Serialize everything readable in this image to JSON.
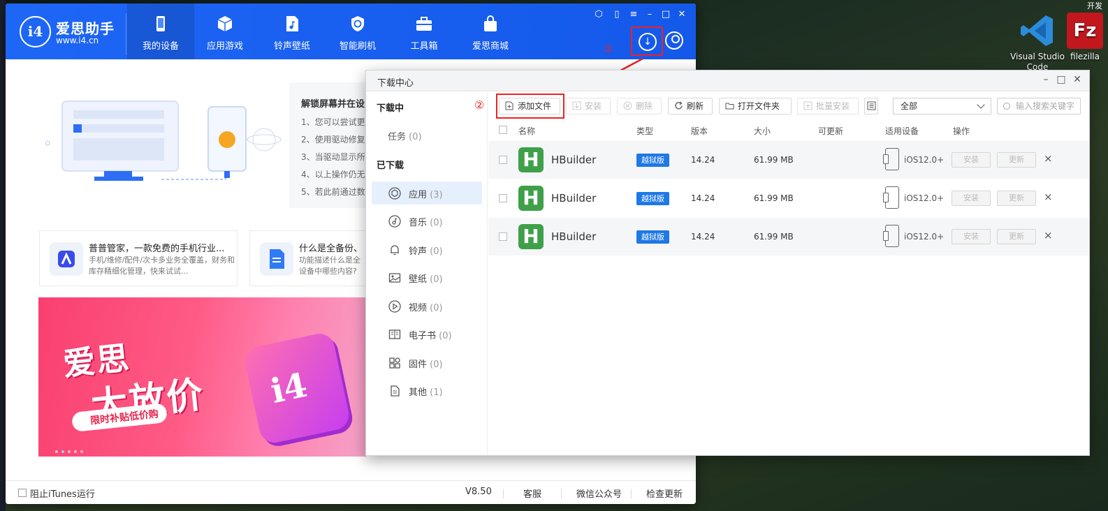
{
  "desktop": {
    "icons": [
      {
        "label": "Visual Studio Code",
        "color": "#2b8cdb"
      },
      {
        "label": "filezilla",
        "color": "#c2171d"
      }
    ],
    "topright_text": "开发"
  },
  "main": {
    "logo_mark": "i4",
    "logo_title": "爱思助手",
    "logo_url": "www.i4.cn",
    "nav": [
      {
        "label": "我的设备",
        "icon": "phone-icon"
      },
      {
        "label": "应用游戏",
        "icon": "cube-icon"
      },
      {
        "label": "铃声壁纸",
        "icon": "music-file-icon"
      },
      {
        "label": "智能刷机",
        "icon": "shield-refresh-icon"
      },
      {
        "label": "工具箱",
        "icon": "toolbox-icon"
      },
      {
        "label": "爱思商城",
        "icon": "shopping-bag-icon"
      }
    ],
    "annotation_1": "①",
    "download_arrow": "↓",
    "unlock": {
      "title": "解锁屏幕并在设",
      "steps": [
        "1、您可以尝试更",
        "2、使用驱动修复",
        "3、当驱动显示所",
        "4、以上操作仍无",
        "5、若此前通过数"
      ]
    },
    "cards": [
      {
        "title": "普普管家，一款免费的手机行业...",
        "desc": "手机/维修/配件/次卡多业务全覆盖，财务和库存精细化管理，快来试试..."
      },
      {
        "title": "什么是全备份、",
        "desc": "功能描述什么是全设备中哪些内容?"
      }
    ],
    "banner": {
      "line1": "爱思",
      "line2": "大放价",
      "pill": "限时补贴低价购",
      "bag_text": "i4"
    },
    "status": {
      "block_itunes": "阻止iTunes运行",
      "version": "V8.50",
      "service": "客服",
      "wechat": "微信公众号",
      "check_update": "检查更新"
    }
  },
  "download_center": {
    "title": "下载中心",
    "downloading_head": "下载中",
    "task_label": "任务",
    "task_count": "(0)",
    "downloaded_head": "已下载",
    "categories": [
      {
        "label": "应用",
        "count": "(3)",
        "icon": "app-cube-icon"
      },
      {
        "label": "音乐",
        "count": "(0)",
        "icon": "music-icon"
      },
      {
        "label": "铃声",
        "count": "(0)",
        "icon": "bell-icon"
      },
      {
        "label": "壁纸",
        "count": "(0)",
        "icon": "image-icon"
      },
      {
        "label": "视频",
        "count": "(0)",
        "icon": "play-icon"
      },
      {
        "label": "电子书",
        "count": "(0)",
        "icon": "book-icon"
      },
      {
        "label": "固件",
        "count": "(0)",
        "icon": "grid-icon"
      },
      {
        "label": "其他",
        "count": "(1)",
        "icon": "document-icon"
      }
    ],
    "annotation_2": "②",
    "toolbar": {
      "add_file": "添加文件",
      "install": "安装",
      "delete": "删除",
      "refresh": "刷新",
      "open_folder": "打开文件夹",
      "batch_install": "批量安装",
      "filter_value": "全部",
      "search_placeholder": "输入搜索关键字"
    },
    "columns": [
      "名称",
      "类型",
      "版本",
      "大小",
      "可更新",
      "适用设备",
      "操作"
    ],
    "rows": [
      {
        "icon_letter": "H",
        "name": "HBuilder",
        "type": "越狱版",
        "version": "14.24",
        "size": "61.99 MB",
        "device": "iOS12.0+",
        "install": "安装",
        "update": "更新",
        "remove": "×"
      },
      {
        "icon_letter": "H",
        "name": "HBuilder",
        "type": "越狱版",
        "version": "14.24",
        "size": "61.99 MB",
        "device": "iOS12.0+",
        "install": "安装",
        "update": "更新",
        "remove": "×"
      },
      {
        "icon_letter": "H",
        "name": "HBuilder",
        "type": "越狱版",
        "version": "14.24",
        "size": "61.99 MB",
        "device": "iOS12.0+",
        "install": "安装",
        "update": "更新",
        "remove": "×"
      }
    ]
  },
  "colors": {
    "brand_blue": "#1e66f5",
    "annotation_red": "#e22222",
    "tag_blue": "#1e78e6",
    "hbuilder_green": "#3fa04a"
  }
}
